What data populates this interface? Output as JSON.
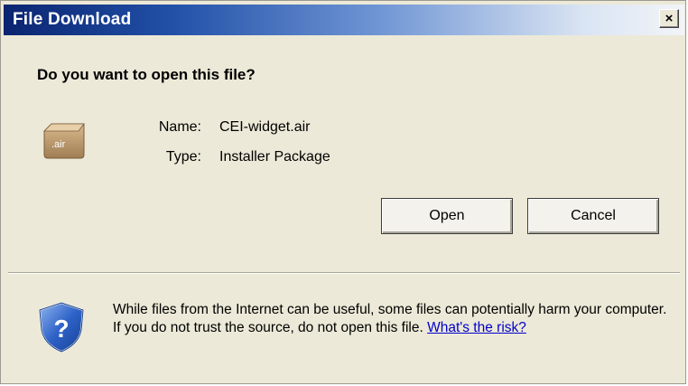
{
  "window": {
    "title": "File Download",
    "close_label": "×"
  },
  "prompt": {
    "question": "Do you want to open this file?"
  },
  "file": {
    "icon_text": ".air",
    "name_label": "Name:",
    "name_value": "CEI-widget.air",
    "type_label": "Type:",
    "type_value": "Installer Package"
  },
  "buttons": {
    "open_label": "Open",
    "cancel_label": "Cancel"
  },
  "warning": {
    "text": "While files from the Internet can be useful, some files can potentially harm your computer. If you do not trust the source, do not open this file.",
    "link_text": "What's the risk?"
  },
  "colors": {
    "title_gradient_start": "#0a2470",
    "title_gradient_end": "#f2f4f8",
    "dialog_background": "#ece9d8",
    "link": "#0000cc"
  }
}
